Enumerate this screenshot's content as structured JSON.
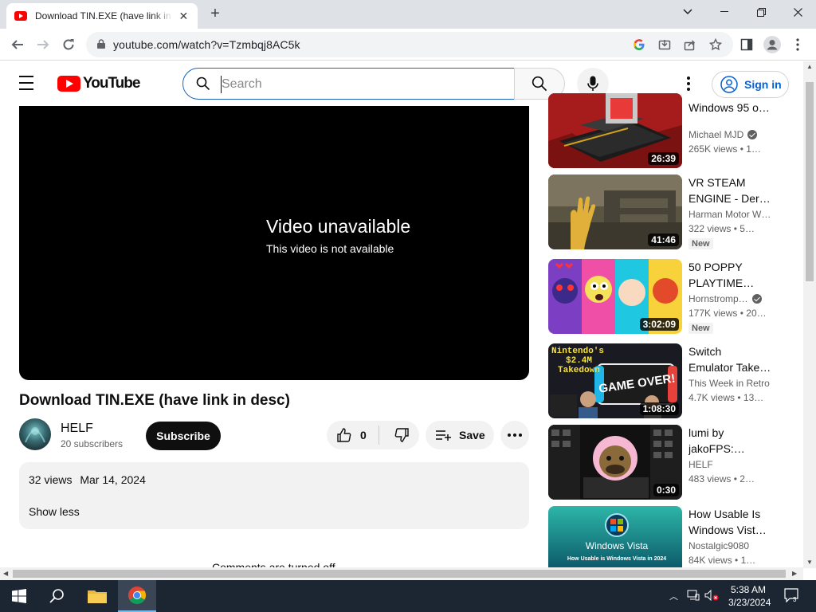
{
  "browser": {
    "tab_title": "Download TIN.EXE (have link in desc)",
    "url": "youtube.com/watch?v=Tzmbqj8AC5k",
    "tab_close": "✕",
    "new_tab": "+"
  },
  "header": {
    "logo_text": "YouTube",
    "search_placeholder": "Search",
    "sign_in": "Sign in"
  },
  "player": {
    "unavailable_title": "Video unavailable",
    "unavailable_sub": "This video is not available"
  },
  "video": {
    "title": "Download TIN.EXE (have link in desc)",
    "channel": "HELF",
    "subscribers": "20 subscribers",
    "subscribe_label": "Subscribe",
    "likes": "0",
    "save_label": "Save",
    "views": "32 views",
    "date": "Mar 14, 2024",
    "show_less": "Show less",
    "comments_off": "Comments are turned off."
  },
  "recommendations": [
    {
      "title_l1": "Windows 95 o…",
      "title_l2": "",
      "channel": "Michael MJD",
      "verified": true,
      "views": "265K views",
      "age": "1…",
      "duration": "26:39",
      "new": false
    },
    {
      "title_l1": "VR STEAM",
      "title_l2": "ENGINE - Dera…",
      "channel": "Harman Motor W…",
      "verified": false,
      "views": "322 views",
      "age": "5…",
      "duration": "41:46",
      "new": true
    },
    {
      "title_l1": "50 POPPY",
      "title_l2": "PLAYTIME…",
      "channel": "Hornstromp…",
      "verified": true,
      "views": "177K views",
      "age": "20…",
      "duration": "3:02:09",
      "new": true
    },
    {
      "title_l1": "Switch",
      "title_l2": "Emulator Take…",
      "channel": "This Week in Retro",
      "verified": false,
      "views": "4.7K views",
      "age": "13…",
      "duration": "1:08:30",
      "new": false
    },
    {
      "title_l1": "lumi by",
      "title_l2": "jakoFPS:…",
      "channel": "HELF",
      "verified": false,
      "views": "483 views",
      "age": "2…",
      "duration": "0:30",
      "new": false
    },
    {
      "title_l1": "How Usable Is",
      "title_l2": "Windows Vist…",
      "channel": "Nostalgic9080",
      "verified": false,
      "views": "84K views",
      "age": "1…",
      "duration": "",
      "new": false
    }
  ],
  "badges": {
    "new": "New",
    "bullet": "•"
  },
  "thumb_text": {
    "t4_line1": "Nintendo's",
    "t4_line2": "$2.4M",
    "t4_line3": "Takedown",
    "t4_game_over": "GAME OVER!",
    "t6_logo": "Windows Vista",
    "t6_caption": "How Usable is Windows Vista in 2024"
  },
  "taskbar": {
    "time": "5:38 AM",
    "date": "3/23/2024",
    "notifications": "3"
  }
}
